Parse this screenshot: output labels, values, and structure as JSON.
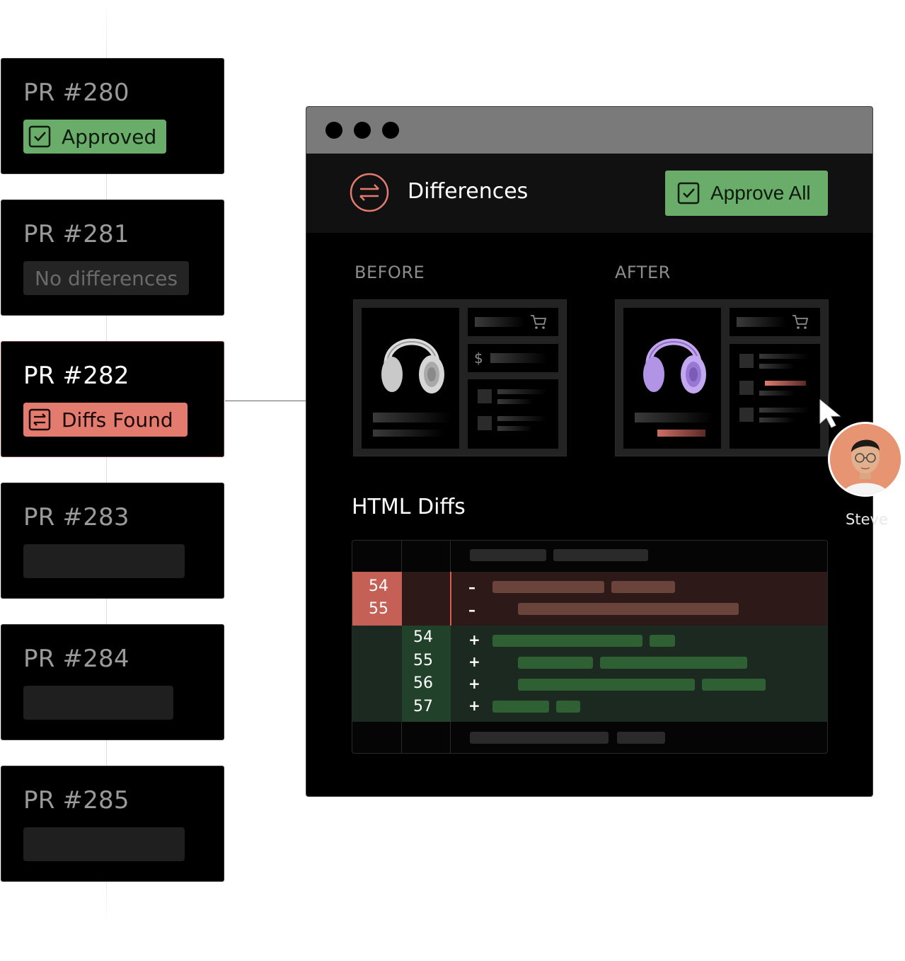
{
  "timeline": {
    "prs": [
      {
        "title": "PR #280",
        "status": "Approved",
        "status_type": "approved"
      },
      {
        "title": "PR #281",
        "status": "No differences",
        "status_type": "none"
      },
      {
        "title": "PR #282",
        "status": "Diffs Found",
        "status_type": "diffs"
      },
      {
        "title": "PR #283",
        "status": "",
        "status_type": "placeholder"
      },
      {
        "title": "PR #284",
        "status": "",
        "status_type": "placeholder"
      },
      {
        "title": "PR #285",
        "status": "",
        "status_type": "placeholder"
      }
    ]
  },
  "window": {
    "header_title": "Differences",
    "approve_all_label": "Approve All",
    "before_label": "BEFORE",
    "after_label": "AFTER",
    "before_price_symbol": "$",
    "html_diffs_title": "HTML Diffs",
    "diff": {
      "removed_lines": [
        "54",
        "55"
      ],
      "added_lines": [
        "54",
        "55",
        "56",
        "57"
      ],
      "removed_sign": "–",
      "added_sign": "+"
    }
  },
  "collaborator": {
    "name": "Steve"
  },
  "colors": {
    "approved": "#6aad6a",
    "diffs": "#e37b6f",
    "removed_bg": "#2d1a18",
    "added_bg": "#1b2921",
    "removed_ln": "#c46055",
    "added_ln": "#21412a"
  },
  "icons": {
    "approved": "check-square-icon",
    "diffs": "diff-doc-icon",
    "header": "swap-arrows-icon",
    "cart": "cart-icon",
    "cursor": "pointer-cursor-icon"
  }
}
